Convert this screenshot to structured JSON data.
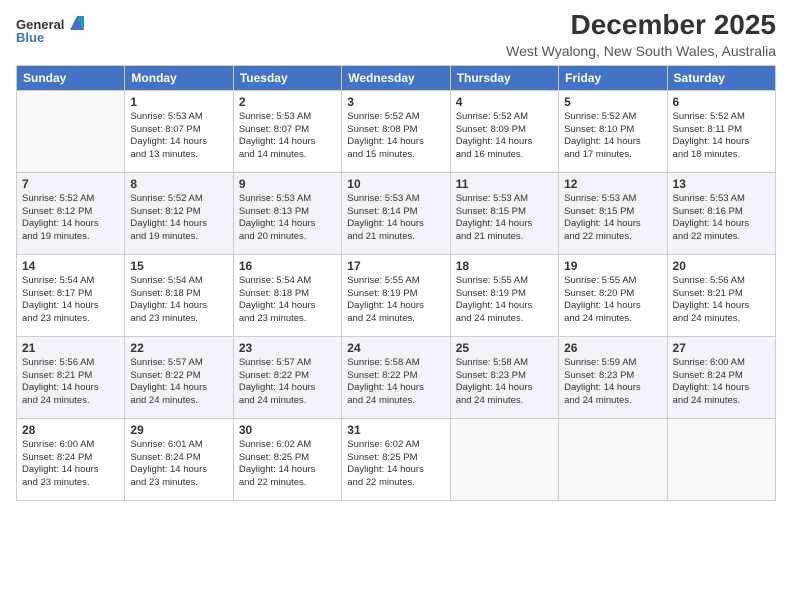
{
  "header": {
    "logo_line1": "General",
    "logo_line2": "Blue",
    "month": "December 2025",
    "location": "West Wyalong, New South Wales, Australia"
  },
  "weekdays": [
    "Sunday",
    "Monday",
    "Tuesday",
    "Wednesday",
    "Thursday",
    "Friday",
    "Saturday"
  ],
  "weeks": [
    [
      {
        "day": "",
        "info": ""
      },
      {
        "day": "1",
        "info": "Sunrise: 5:53 AM\nSunset: 8:07 PM\nDaylight: 14 hours\nand 13 minutes."
      },
      {
        "day": "2",
        "info": "Sunrise: 5:53 AM\nSunset: 8:07 PM\nDaylight: 14 hours\nand 14 minutes."
      },
      {
        "day": "3",
        "info": "Sunrise: 5:52 AM\nSunset: 8:08 PM\nDaylight: 14 hours\nand 15 minutes."
      },
      {
        "day": "4",
        "info": "Sunrise: 5:52 AM\nSunset: 8:09 PM\nDaylight: 14 hours\nand 16 minutes."
      },
      {
        "day": "5",
        "info": "Sunrise: 5:52 AM\nSunset: 8:10 PM\nDaylight: 14 hours\nand 17 minutes."
      },
      {
        "day": "6",
        "info": "Sunrise: 5:52 AM\nSunset: 8:11 PM\nDaylight: 14 hours\nand 18 minutes."
      }
    ],
    [
      {
        "day": "7",
        "info": "Sunrise: 5:52 AM\nSunset: 8:12 PM\nDaylight: 14 hours\nand 19 minutes."
      },
      {
        "day": "8",
        "info": "Sunrise: 5:52 AM\nSunset: 8:12 PM\nDaylight: 14 hours\nand 19 minutes."
      },
      {
        "day": "9",
        "info": "Sunrise: 5:53 AM\nSunset: 8:13 PM\nDaylight: 14 hours\nand 20 minutes."
      },
      {
        "day": "10",
        "info": "Sunrise: 5:53 AM\nSunset: 8:14 PM\nDaylight: 14 hours\nand 21 minutes."
      },
      {
        "day": "11",
        "info": "Sunrise: 5:53 AM\nSunset: 8:15 PM\nDaylight: 14 hours\nand 21 minutes."
      },
      {
        "day": "12",
        "info": "Sunrise: 5:53 AM\nSunset: 8:15 PM\nDaylight: 14 hours\nand 22 minutes."
      },
      {
        "day": "13",
        "info": "Sunrise: 5:53 AM\nSunset: 8:16 PM\nDaylight: 14 hours\nand 22 minutes."
      }
    ],
    [
      {
        "day": "14",
        "info": "Sunrise: 5:54 AM\nSunset: 8:17 PM\nDaylight: 14 hours\nand 23 minutes."
      },
      {
        "day": "15",
        "info": "Sunrise: 5:54 AM\nSunset: 8:18 PM\nDaylight: 14 hours\nand 23 minutes."
      },
      {
        "day": "16",
        "info": "Sunrise: 5:54 AM\nSunset: 8:18 PM\nDaylight: 14 hours\nand 23 minutes."
      },
      {
        "day": "17",
        "info": "Sunrise: 5:55 AM\nSunset: 8:19 PM\nDaylight: 14 hours\nand 24 minutes."
      },
      {
        "day": "18",
        "info": "Sunrise: 5:55 AM\nSunset: 8:19 PM\nDaylight: 14 hours\nand 24 minutes."
      },
      {
        "day": "19",
        "info": "Sunrise: 5:55 AM\nSunset: 8:20 PM\nDaylight: 14 hours\nand 24 minutes."
      },
      {
        "day": "20",
        "info": "Sunrise: 5:56 AM\nSunset: 8:21 PM\nDaylight: 14 hours\nand 24 minutes."
      }
    ],
    [
      {
        "day": "21",
        "info": "Sunrise: 5:56 AM\nSunset: 8:21 PM\nDaylight: 14 hours\nand 24 minutes."
      },
      {
        "day": "22",
        "info": "Sunrise: 5:57 AM\nSunset: 8:22 PM\nDaylight: 14 hours\nand 24 minutes."
      },
      {
        "day": "23",
        "info": "Sunrise: 5:57 AM\nSunset: 8:22 PM\nDaylight: 14 hours\nand 24 minutes."
      },
      {
        "day": "24",
        "info": "Sunrise: 5:58 AM\nSunset: 8:22 PM\nDaylight: 14 hours\nand 24 minutes."
      },
      {
        "day": "25",
        "info": "Sunrise: 5:58 AM\nSunset: 8:23 PM\nDaylight: 14 hours\nand 24 minutes."
      },
      {
        "day": "26",
        "info": "Sunrise: 5:59 AM\nSunset: 8:23 PM\nDaylight: 14 hours\nand 24 minutes."
      },
      {
        "day": "27",
        "info": "Sunrise: 6:00 AM\nSunset: 8:24 PM\nDaylight: 14 hours\nand 24 minutes."
      }
    ],
    [
      {
        "day": "28",
        "info": "Sunrise: 6:00 AM\nSunset: 8:24 PM\nDaylight: 14 hours\nand 23 minutes."
      },
      {
        "day": "29",
        "info": "Sunrise: 6:01 AM\nSunset: 8:24 PM\nDaylight: 14 hours\nand 23 minutes."
      },
      {
        "day": "30",
        "info": "Sunrise: 6:02 AM\nSunset: 8:25 PM\nDaylight: 14 hours\nand 22 minutes."
      },
      {
        "day": "31",
        "info": "Sunrise: 6:02 AM\nSunset: 8:25 PM\nDaylight: 14 hours\nand 22 minutes."
      },
      {
        "day": "",
        "info": ""
      },
      {
        "day": "",
        "info": ""
      },
      {
        "day": "",
        "info": ""
      }
    ]
  ]
}
